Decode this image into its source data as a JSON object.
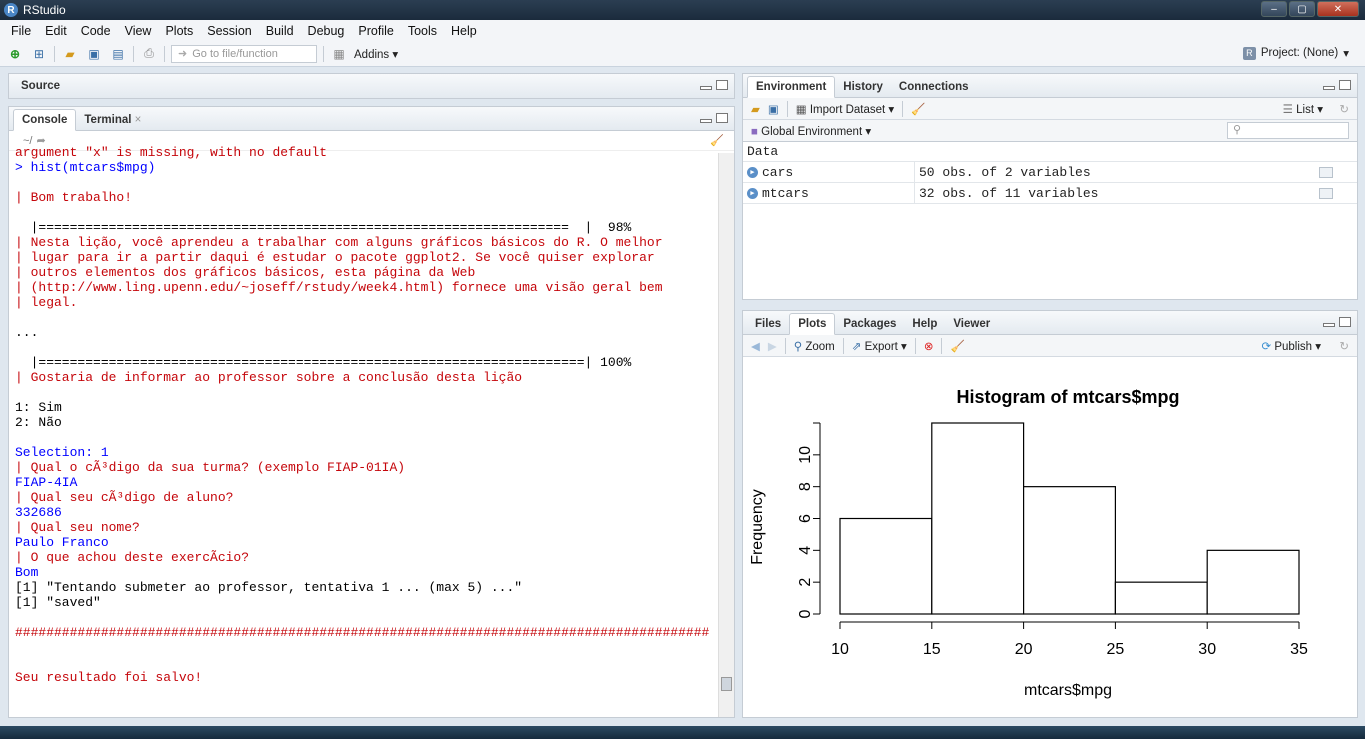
{
  "window": {
    "title": "RStudio",
    "controls": [
      "–",
      "▢",
      "✕"
    ]
  },
  "menu": [
    "File",
    "Edit",
    "Code",
    "View",
    "Plots",
    "Session",
    "Build",
    "Debug",
    "Profile",
    "Tools",
    "Help"
  ],
  "toolbar": {
    "goto_placeholder": "Go to file/function",
    "addins": "Addins",
    "project": "Project: (None)"
  },
  "source_pane": {
    "title": "Source"
  },
  "console_pane": {
    "tabs": [
      "Console",
      "Terminal"
    ],
    "path": "~/",
    "lines": [
      {
        "text": "argument \"x\" is missing, with no default",
        "color": "#c5060b"
      },
      {
        "text": "> hist(mtcars$mpg)",
        "color": "#0000ff"
      },
      {
        "text": "",
        "color": "#000000"
      },
      {
        "text": "| Bom trabalho!",
        "color": "#c5060b"
      },
      {
        "text": "",
        "color": "#000000"
      },
      {
        "text": "  |====================================================================  |  98%",
        "color": "#000000"
      },
      {
        "text": "| Nesta lição, você aprendeu a trabalhar com alguns gráficos básicos do R. O melhor",
        "color": "#c5060b"
      },
      {
        "text": "| lugar para ir a partir daqui é estudar o pacote ggplot2. Se você quiser explorar",
        "color": "#c5060b"
      },
      {
        "text": "| outros elementos dos gráficos básicos, esta página da Web",
        "color": "#c5060b"
      },
      {
        "text": "| (http://www.ling.upenn.edu/~joseff/rstudy/week4.html) fornece uma visão geral bem",
        "color": "#c5060b"
      },
      {
        "text": "| legal.",
        "color": "#c5060b"
      },
      {
        "text": "",
        "color": "#000000"
      },
      {
        "text": "...",
        "color": "#000000"
      },
      {
        "text": "",
        "color": "#000000"
      },
      {
        "text": "  |======================================================================| 100%",
        "color": "#000000"
      },
      {
        "text": "| Gostaria de informar ao professor sobre a conclusão desta lição",
        "color": "#c5060b"
      },
      {
        "text": "",
        "color": "#000000"
      },
      {
        "text": "1: Sim",
        "color": "#000000"
      },
      {
        "text": "2: Não",
        "color": "#000000"
      },
      {
        "text": "",
        "color": "#000000"
      },
      {
        "text": "Selection: 1",
        "color": "#0000ff"
      },
      {
        "text": "| Qual o cÃ³digo da sua turma? (exemplo FIAP-01IA)",
        "color": "#c5060b"
      },
      {
        "text": "FIAP-4IA",
        "color": "#0000ff"
      },
      {
        "text": "| Qual seu cÃ³digo de aluno?",
        "color": "#c5060b"
      },
      {
        "text": "332686",
        "color": "#0000ff"
      },
      {
        "text": "| Qual seu nome?",
        "color": "#c5060b"
      },
      {
        "text": "Paulo Franco",
        "color": "#0000ff"
      },
      {
        "text": "| O que achou deste exercÃ­cio?",
        "color": "#c5060b"
      },
      {
        "text": "Bom",
        "color": "#0000ff"
      },
      {
        "text": "[1] \"Tentando submeter ao professor, tentativa 1 ... (max 5) ...\"",
        "color": "#000000"
      },
      {
        "text": "[1] \"saved\"",
        "color": "#000000"
      },
      {
        "text": "",
        "color": "#000000"
      },
      {
        "text": "#########################################################################################",
        "color": "#c5060b"
      },
      {
        "text": "",
        "color": "#000000"
      },
      {
        "text": "",
        "color": "#000000"
      },
      {
        "text": "Seu resultado foi salvo!",
        "color": "#c5060b"
      }
    ]
  },
  "env_pane": {
    "tabs": [
      "Environment",
      "History",
      "Connections"
    ],
    "import_label": "Import Dataset",
    "list_label": "List",
    "scope": "Global Environment",
    "section": "Data",
    "rows": [
      {
        "name": "cars",
        "value": "50 obs. of 2 variables"
      },
      {
        "name": "mtcars",
        "value": "32 obs. of 11 variables"
      }
    ]
  },
  "files_pane": {
    "tabs": [
      "Files",
      "Plots",
      "Packages",
      "Help",
      "Viewer"
    ],
    "zoom": "Zoom",
    "export": "Export",
    "publish": "Publish"
  },
  "chart_data": {
    "type": "bar",
    "title": "Histogram of mtcars$mpg",
    "xlabel": "mtcars$mpg",
    "ylabel": "Frequency",
    "bins": [
      [
        10,
        15
      ],
      [
        15,
        20
      ],
      [
        20,
        25
      ],
      [
        25,
        30
      ],
      [
        30,
        35
      ]
    ],
    "values": [
      6,
      12,
      8,
      2,
      4
    ],
    "xticks": [
      10,
      15,
      20,
      25,
      30,
      35
    ],
    "yticks": [
      0,
      2,
      4,
      6,
      8,
      10
    ],
    "xlim": [
      10,
      35
    ],
    "ylim": [
      0,
      12
    ]
  }
}
